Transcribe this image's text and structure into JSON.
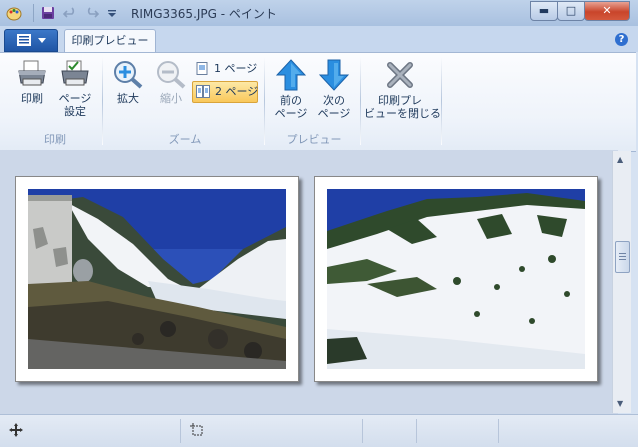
{
  "window": {
    "title": "RIMG3365.JPG - ペイント",
    "minimize_icon": "minimize-icon",
    "maximize_icon": "maximize-icon",
    "close_icon": "close-icon",
    "minimize_glyph": "▬",
    "maximize_glyph": "□",
    "close_glyph": "✕"
  },
  "quick_access": {
    "save_icon": "save-icon",
    "undo_icon": "undo-icon",
    "redo_icon": "redo-icon",
    "customize_icon": "dropdown-arrow-icon"
  },
  "tabs": {
    "app_menu_icon": "app-menu-icon",
    "active_tab": "印刷プレビュー",
    "help_glyph": "?"
  },
  "ribbon": {
    "groups": {
      "print": {
        "label": "印刷",
        "print_button": "印刷",
        "page_setup_line1": "ページ",
        "page_setup_line2": "設定"
      },
      "zoom": {
        "label": "ズーム",
        "zoom_in": "拡大",
        "zoom_out": "縮小",
        "one_page": "1 ページ",
        "two_page": "2 ページ"
      },
      "preview": {
        "label": "プレビュー",
        "prev_line1": "前の",
        "prev_line2": "ページ",
        "next_line1": "次の",
        "next_line2": "ページ"
      },
      "close": {
        "close_line1": "印刷プレ",
        "close_line2": "ビューを閉じる"
      }
    }
  },
  "preview": {
    "pages": [
      {
        "name": "page-1",
        "image": "mountain-snow-photo-1"
      },
      {
        "name": "page-2",
        "image": "mountain-snow-photo-2"
      }
    ]
  },
  "status": {
    "move_icon": "move-cursor-icon",
    "selection_icon": "selection-size-icon"
  },
  "colors": {
    "accent": "#1f55a5",
    "active_button": "#f9c85b",
    "arrow_blue": "#2a8ee0",
    "close_red": "#c9452b"
  }
}
